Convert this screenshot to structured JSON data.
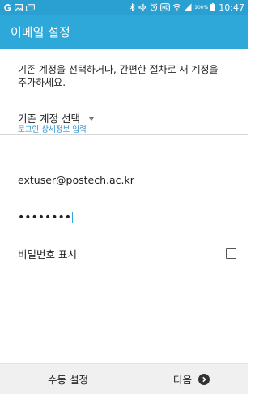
{
  "status_bar": {
    "battery_percent": "100%",
    "time": "10:47",
    "icons": [
      "notification-g-icon",
      "image-icon",
      "gallery-icon",
      "bluetooth-icon",
      "mute-icon",
      "alarm-icon",
      "hd-icon",
      "wifi-icon",
      "signal-icon",
      "battery-icon"
    ]
  },
  "header": {
    "title": "이메일 설정"
  },
  "main": {
    "description": "기존 계정을 선택하거나, 간편한 절차로 새 계정을 추가하세요.",
    "account_select": {
      "label": "기존 계정 선택"
    },
    "section_header": "로그인 상세정보 입력",
    "email_value": "extuser@postech.ac.kr",
    "password_mask": "••••••••",
    "show_password": {
      "label": "비밀번호 표시",
      "checked": false
    }
  },
  "footer": {
    "manual_setup_label": "수동 설정",
    "next_label": "다음"
  },
  "colors": {
    "accent": "#2ea7d9",
    "status_bar": "#2aa0d2"
  }
}
